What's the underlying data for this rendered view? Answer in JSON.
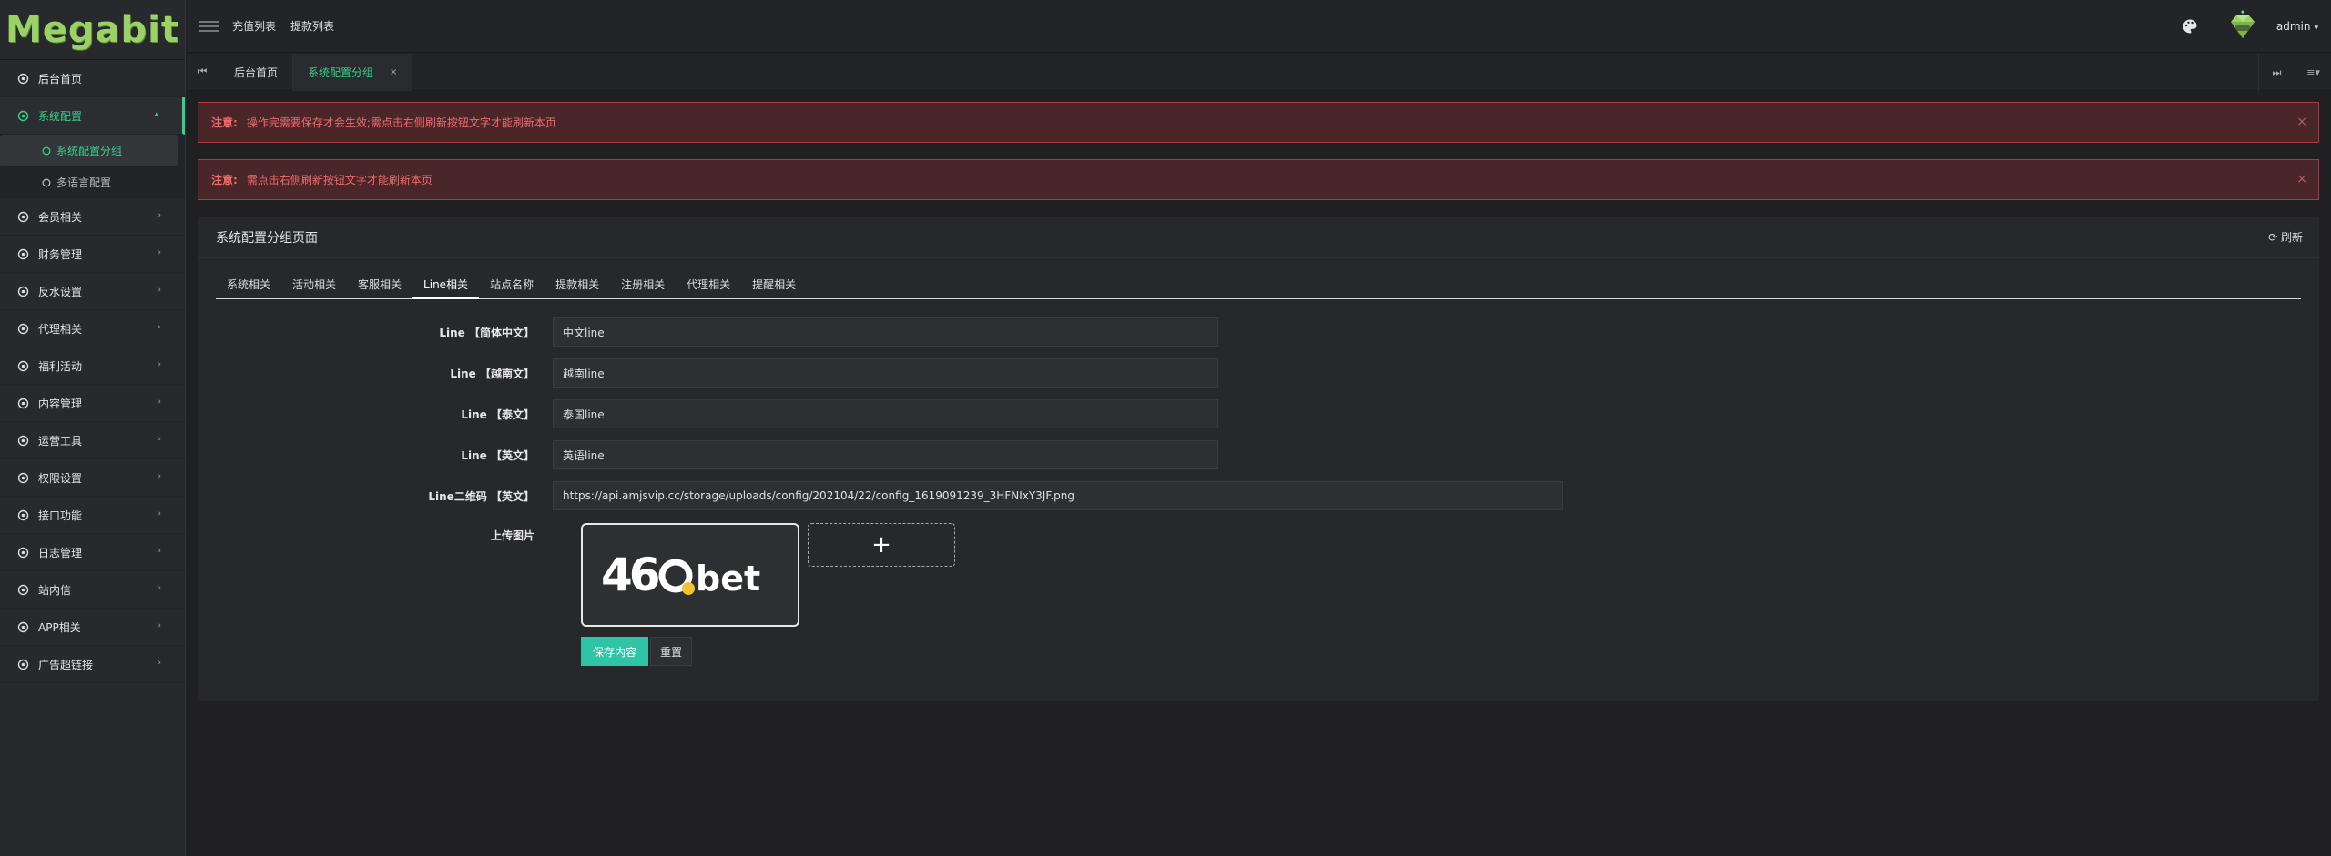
{
  "app": {
    "logo": "Megabit"
  },
  "sidebar": {
    "items": [
      {
        "label": "后台首页"
      },
      {
        "label": "系统配置"
      },
      {
        "label": "会员相关"
      },
      {
        "label": "财务管理"
      },
      {
        "label": "反水设置"
      },
      {
        "label": "代理相关"
      },
      {
        "label": "福利活动"
      },
      {
        "label": "内容管理"
      },
      {
        "label": "运营工具"
      },
      {
        "label": "权限设置"
      },
      {
        "label": "接口功能"
      },
      {
        "label": "日志管理"
      },
      {
        "label": "站内信"
      },
      {
        "label": "APP相关"
      },
      {
        "label": "广告超链接"
      }
    ],
    "sub_items": [
      {
        "label": "系统配置分组"
      },
      {
        "label": "多语言配置"
      }
    ]
  },
  "header": {
    "links": [
      "充值列表",
      "提款列表"
    ],
    "user": "admin"
  },
  "tabs": [
    {
      "label": "后台首页"
    },
    {
      "label": "系统配置分组"
    }
  ],
  "alerts": [
    {
      "prefix": "注意:",
      "text": "操作完需要保存才会生效;需点击右侧刷新按钮文字才能刷新本页"
    },
    {
      "prefix": "注意:",
      "text": "需点击右侧刷新按钮文字才能刷新本页"
    }
  ],
  "panel": {
    "title": "系统配置分组页面",
    "refresh": "刷新",
    "tabs": [
      "系统相关",
      "活动相关",
      "客服相关",
      "Line相关",
      "站点名称",
      "提款相关",
      "注册相关",
      "代理相关",
      "提醒相关"
    ],
    "fields": [
      {
        "label": "Line 【简体中文】",
        "value": "中文line"
      },
      {
        "label": "Line 【越南文】",
        "value": "越南line"
      },
      {
        "label": "Line 【泰文】",
        "value": "泰国line"
      },
      {
        "label": "Line 【英文】",
        "value": "英语line"
      },
      {
        "label": "Line二维码 【英文】",
        "value": "https://api.amjsvip.cc/storage/uploads/config/202104/22/config_1619091239_3HFNIxY3JF.png"
      }
    ],
    "upload_label": "上传图片",
    "upload_logo_text": "460.bet",
    "upload_add": "+",
    "save": "保存内容",
    "reset": "重置"
  },
  "colors": {
    "accent": "#37d08b",
    "save": "#2ec4a5",
    "alert_bg": "#4a2628",
    "alert_border": "#b23a3f",
    "logo": "#9bd267"
  }
}
